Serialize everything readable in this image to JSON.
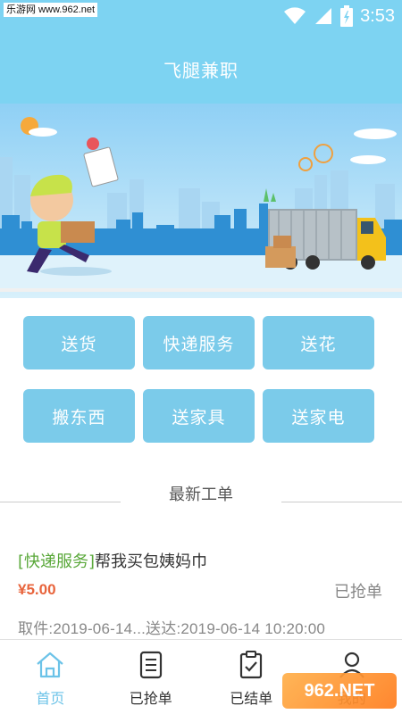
{
  "status_bar": {
    "watermark": "乐游网 www.962.net",
    "time": "3:53",
    "icons": [
      "wifi-icon",
      "signal-icon",
      "battery-icon"
    ]
  },
  "header": {
    "title": "飞腿兼职"
  },
  "banner": {
    "description_icons": [
      "delivery-boy",
      "delivery-truck",
      "city-skyline"
    ]
  },
  "categories": [
    {
      "label": "送货"
    },
    {
      "label": "快递服务"
    },
    {
      "label": "送花"
    },
    {
      "label": "搬东西"
    },
    {
      "label": "送家具"
    },
    {
      "label": "送家电"
    }
  ],
  "section": {
    "title": "最新工单"
  },
  "order": {
    "tag": "[快递服务]",
    "title": "帮我买包姨妈巾",
    "price": "¥5.00",
    "status": "已抢单",
    "time": "取件:2019-06-14...送达:2019-06-14 10:20:00"
  },
  "bottom_nav": [
    {
      "label": "首页",
      "icon": "home-icon",
      "active": true
    },
    {
      "label": "已抢单",
      "icon": "document-icon",
      "active": false
    },
    {
      "label": "已结单",
      "icon": "clipboard-check-icon",
      "active": false
    },
    {
      "label": "我的",
      "icon": "user-icon",
      "active": false
    }
  ],
  "corner_logo": {
    "text": "962.NET"
  },
  "colors": {
    "primary": "#7dd3f2",
    "button": "#7bcbea",
    "tag": "#5aa83a",
    "price": "#e8643c"
  }
}
